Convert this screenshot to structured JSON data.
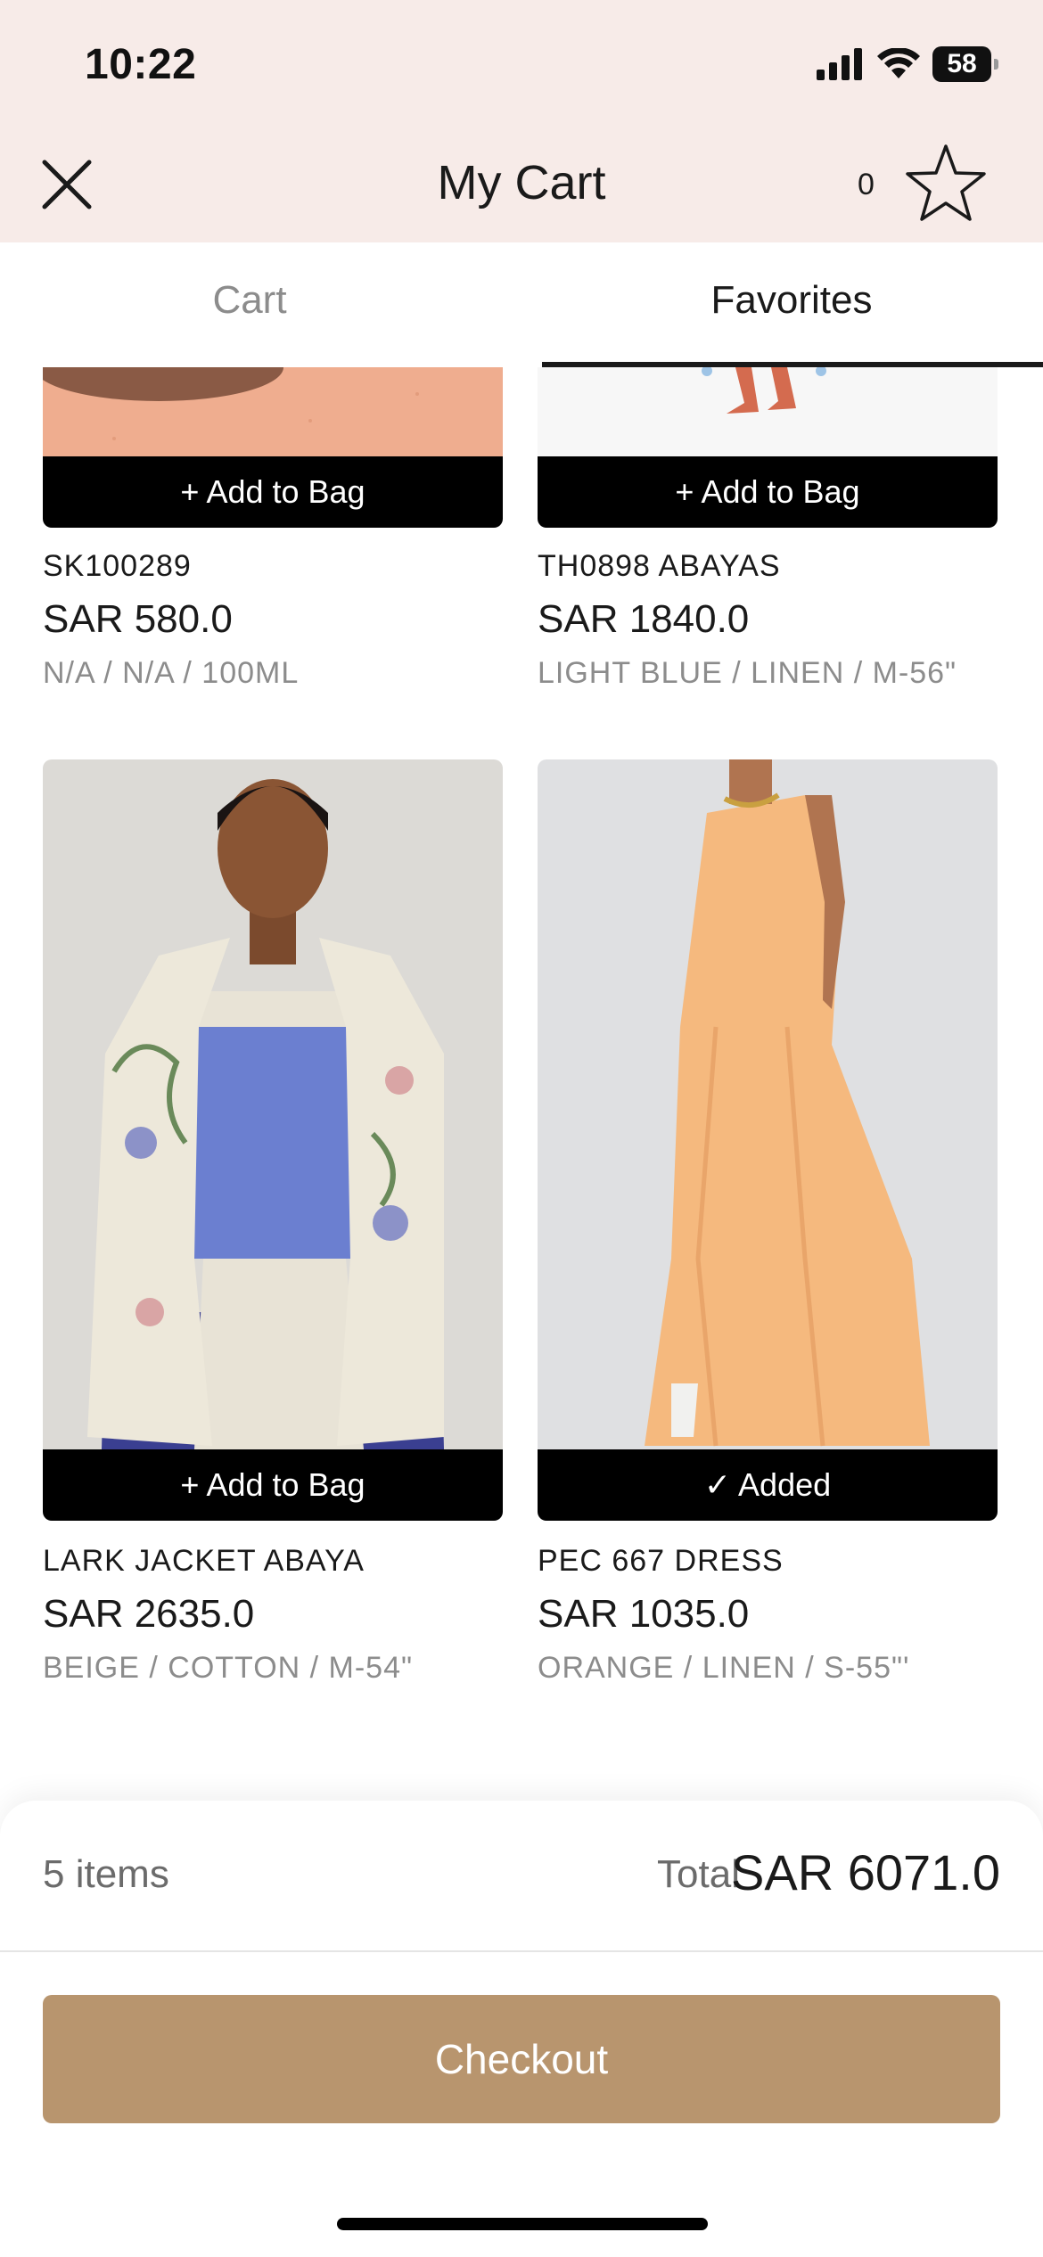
{
  "status_bar": {
    "time": "10:22",
    "battery": "58"
  },
  "header": {
    "title": "My Cart",
    "favorites_count": "0"
  },
  "tabs": [
    {
      "label": "Cart",
      "active": false
    },
    {
      "label": "Favorites",
      "active": true
    }
  ],
  "products": [
    {
      "name": "SK100289",
      "price": "SAR 580.0",
      "variant": "N/A / N/A / 100ML",
      "button": "+ Add to Bag"
    },
    {
      "name": "TH0898 ABAYAS",
      "price": "SAR 1840.0",
      "variant": "LIGHT BLUE / LINEN / M-56\"",
      "button": "+ Add to Bag"
    },
    {
      "name": "LARK JACKET ABAYA",
      "price": "SAR 2635.0",
      "variant": "BEIGE / COTTON / M-54\"",
      "button": "+ Add to Bag"
    },
    {
      "name": "PEC 667 DRESS",
      "price": "SAR 1035.0",
      "variant": "ORANGE / LINEN / S-55\"'",
      "button": "✓ Added"
    }
  ],
  "summary": {
    "items": "5 items",
    "total_label": "Total",
    "total_value": "SAR 6071.0",
    "checkout_label": "Checkout"
  },
  "colors": {
    "header_bg": "#f7ebe8",
    "checkout": "#b8956e",
    "button": "#000000"
  }
}
